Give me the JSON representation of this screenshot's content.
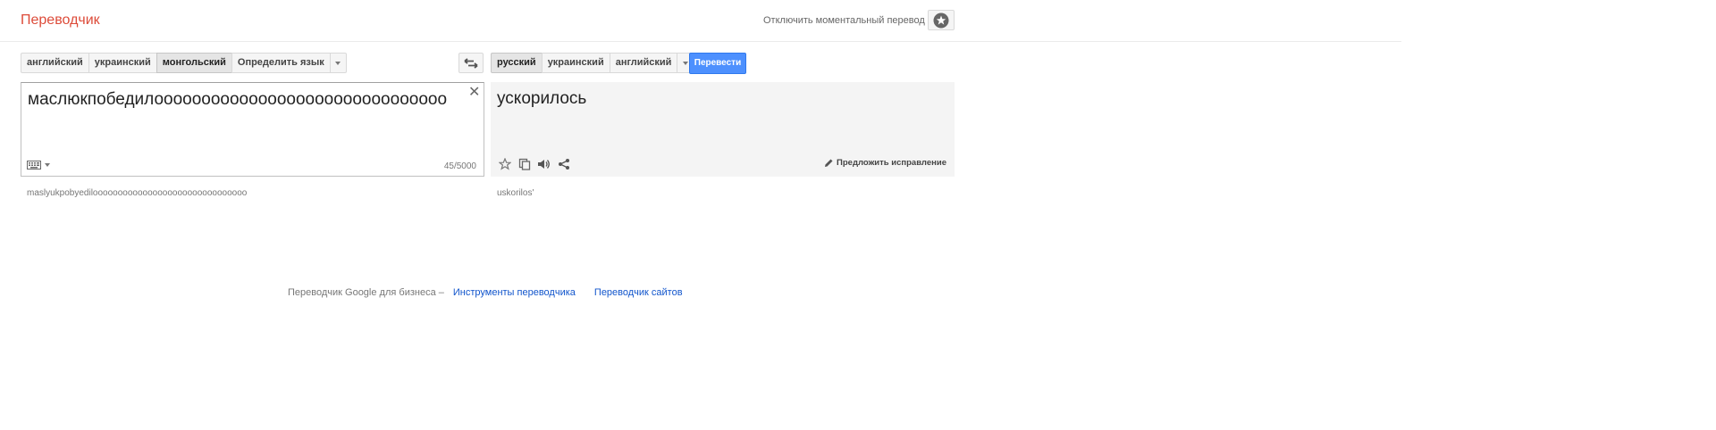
{
  "header": {
    "logo": "Переводчик",
    "instant_toggle": "Отключить моментальный перевод",
    "starred_icon": "star-icon"
  },
  "source": {
    "languages": [
      "английский",
      "украинский",
      "монгольский",
      "Определить язык"
    ],
    "selected": "монгольский",
    "text": "маслюкпобедилооооооооооооооооооооооооооооооо",
    "char_count": "45/5000",
    "transliteration": "maslyukpobyedilooooooooooooooooooooooooooooooo"
  },
  "target": {
    "languages": [
      "русский",
      "украинский",
      "английский"
    ],
    "selected": "русский",
    "translate_button": "Перевести",
    "text": "ускорилось",
    "suggest": "Предложить исправление",
    "transliteration": "uskorilos'"
  },
  "footer": {
    "business_text": "Переводчик Google для бизнеса –",
    "toolkit_link": "Инструменты переводчика",
    "sites_link": "Переводчик сайтов"
  }
}
